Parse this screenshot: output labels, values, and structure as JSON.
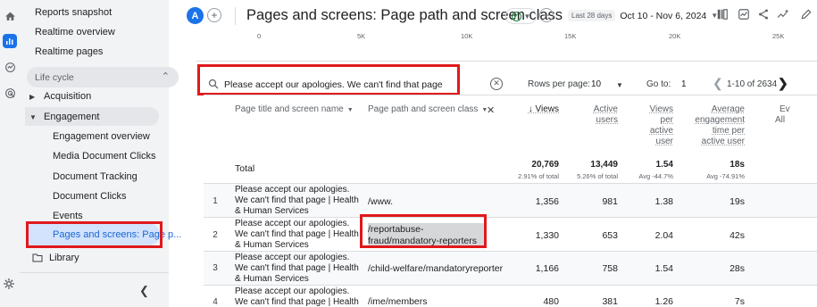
{
  "sidebar": {
    "top_items": [
      "Reports snapshot",
      "Realtime overview",
      "Realtime pages"
    ],
    "section": "Life cycle",
    "acquisition": "Acquisition",
    "engagement": "Engagement",
    "engagement_children": [
      "Engagement overview",
      "Media Document Clicks",
      "Document Tracking",
      "Document Clicks",
      "Events",
      "Pages and screens: Page p..."
    ],
    "library": "Library"
  },
  "header": {
    "avatar_letter": "A",
    "title": "Pages and screens: Page path and screen class",
    "date_chip": "Last 28 days",
    "date_range": "Oct 10 - Nov 6, 2024"
  },
  "axis_ticks": [
    "0",
    "5K",
    "10K",
    "15K",
    "20K",
    "25K"
  ],
  "search": {
    "value": "Please accept our apologies. We can't find that page"
  },
  "pagination": {
    "rows_label": "Rows per page:",
    "rows_value": "10",
    "goto_label": "Go to:",
    "goto_value": "1",
    "range": "1-10 of 2634"
  },
  "table": {
    "dim1": "Page title and screen name",
    "dim2": "Page path and screen class",
    "metric_headers": {
      "views": "Views",
      "active_users": "Active users",
      "views_per_user": "Views per active user",
      "avg_time": "Average engagement time per active user",
      "events": "Ev",
      "events_sub": "All"
    },
    "total": {
      "label": "Total",
      "views": "20,769",
      "views_sub": "2.91% of total",
      "active_users": "13,449",
      "active_users_sub": "5.26% of total",
      "views_per_user": "1.54",
      "views_per_user_sub": "Avg -44.7%",
      "avg_time": "18s",
      "avg_time_sub": "Avg -74.91%"
    },
    "rows": [
      {
        "idx": "1",
        "title": "Please accept our apologies. We can't find that page | Health & Human Services",
        "path": "/www.",
        "views": "1,356",
        "users": "981",
        "vpu": "1.38",
        "time": "19s"
      },
      {
        "idx": "2",
        "title": "Please accept our apologies. We can't find that page | Health & Human Services",
        "path": "/reportabuse-fraud/mandatory-reporters",
        "views": "1,330",
        "users": "653",
        "vpu": "2.04",
        "time": "42s"
      },
      {
        "idx": "3",
        "title": "Please accept our apologies. We can't find that page | Health & Human Services",
        "path": "/child-welfare/mandatoryreporter",
        "views": "1,166",
        "users": "758",
        "vpu": "1.54",
        "time": "28s"
      },
      {
        "idx": "4",
        "title": "Please accept our apologies. We can't find that page | Health",
        "path": "/ime/members",
        "views": "480",
        "users": "381",
        "vpu": "1.26",
        "time": "7s"
      }
    ]
  },
  "colors": {
    "accent": "#1a73e8",
    "annotation_red": "#e0191c",
    "active_nav_bg": "#d3e3fd"
  }
}
